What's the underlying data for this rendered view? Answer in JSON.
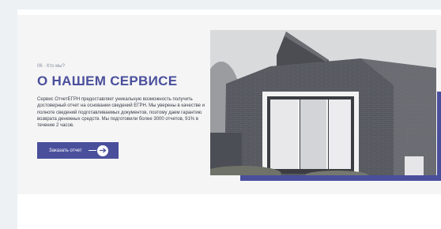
{
  "section": {
    "meta": "06 · Кто мы?",
    "title": "О НАШЕМ СЕРВИСЕ",
    "description": "Сервис ОтчетЕГРН предоставляет уникальную возможность получить достоверный отчет на основании сведений ЕГРН. Мы уверены в качестве и полноте сведений подготавливаемых документов, поэтому даем гарантию возврата денежных средств. Мы подготовили более 3000 отчетов, 91% в течение 2 часов.",
    "cta_label": "Заказать отчет",
    "cta_icon": "arrow-right-icon",
    "image_icon": "house-photo"
  },
  "colors": {
    "accent": "#4a4f9c",
    "page_background": "#eef1f4",
    "band_background": "#f5f5f5"
  }
}
